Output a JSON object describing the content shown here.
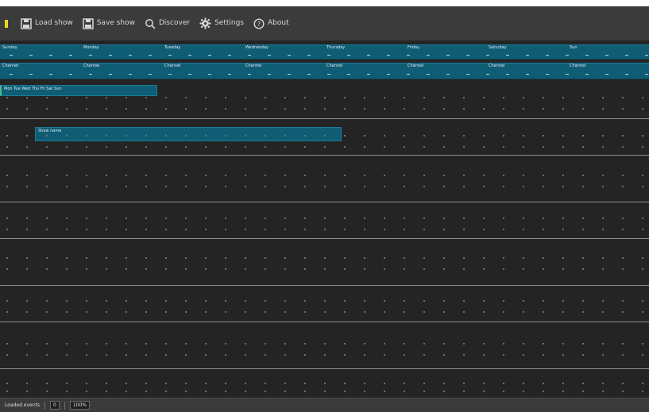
{
  "toolbar": {
    "accent_color": "#f0d51e",
    "buttons": [
      {
        "label": "Load show",
        "icon": "save-icon"
      },
      {
        "label": "Save show",
        "icon": "save-icon"
      },
      {
        "label": "Discover",
        "icon": "search-icon"
      },
      {
        "label": "Settings",
        "icon": "gear-icon"
      },
      {
        "label": "About",
        "icon": "help-icon"
      }
    ]
  },
  "calendar": {
    "accent_color": "#0f5d75",
    "day_headers": [
      "Sunday",
      "Monday",
      "Tuesday",
      "Wednesday",
      "Thursday",
      "Friday",
      "Saturday",
      "Sun"
    ],
    "channel_headers": [
      "Channel",
      "Channel",
      "Channel",
      "Channel",
      "Channel",
      "Channel",
      "Channel",
      "Channel"
    ],
    "events": [
      {
        "label": "Mon  Tue  Wed  Thu  Fri  Sat  Sun"
      },
      {
        "label": "Show name"
      }
    ]
  },
  "status_bar": {
    "label": "Loaded events",
    "field_value": "0",
    "zoom": "100%"
  }
}
